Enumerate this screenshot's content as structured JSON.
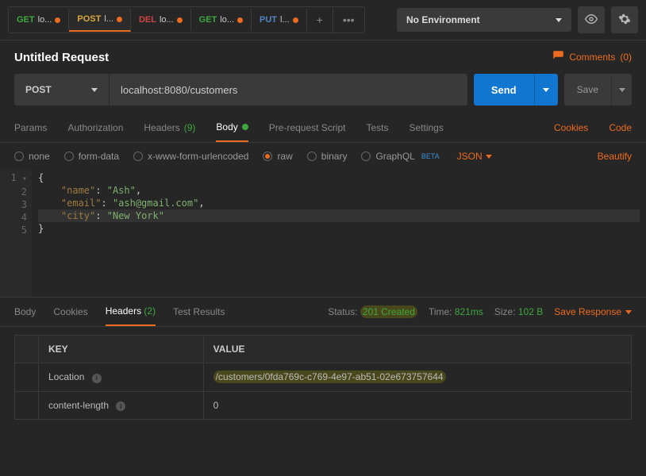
{
  "topBar": {
    "tabs": [
      {
        "method": "GET",
        "label": "lo...",
        "methodClass": "method-get"
      },
      {
        "method": "POST",
        "label": "l...",
        "methodClass": "method-post",
        "active": true
      },
      {
        "method": "DEL",
        "label": "lo...",
        "methodClass": "method-del"
      },
      {
        "method": "GET",
        "label": "lo...",
        "methodClass": "method-get"
      },
      {
        "method": "PUT",
        "label": "l...",
        "methodClass": "method-put"
      }
    ],
    "envLabel": "No Environment"
  },
  "request": {
    "title": "Untitled Request",
    "commentsLabel": "Comments",
    "commentsCount": "(0)",
    "method": "POST",
    "url": "localhost:8080/customers",
    "sendLabel": "Send",
    "saveLabel": "Save"
  },
  "reqTabs": {
    "params": "Params",
    "authorization": "Authorization",
    "headers": "Headers",
    "headersCount": "(9)",
    "body": "Body",
    "prerequest": "Pre-request Script",
    "tests": "Tests",
    "settings": "Settings",
    "cookies": "Cookies",
    "code": "Code"
  },
  "bodyOptions": {
    "none": "none",
    "formData": "form-data",
    "xwww": "x-www-form-urlencoded",
    "raw": "raw",
    "binary": "binary",
    "graphql": "GraphQL",
    "beta": "BETA",
    "json": "JSON",
    "beautify": "Beautify"
  },
  "editor": {
    "lines": [
      "1",
      "2",
      "3",
      "4",
      "5"
    ],
    "content": {
      "l1": "{",
      "l2a": "\"name\"",
      "l2b": ": ",
      "l2c": "\"Ash\"",
      "l2d": ",",
      "l3a": "\"email\"",
      "l3b": ": ",
      "l3c": "\"ash@gmail.com\"",
      "l3d": ",",
      "l4a": "\"city\"",
      "l4b": ": ",
      "l4c": "\"New York\"",
      "l5": "}"
    }
  },
  "respTabs": {
    "body": "Body",
    "cookies": "Cookies",
    "headers": "Headers",
    "headersCount": "(2)",
    "testResults": "Test Results"
  },
  "respMeta": {
    "statusLabel": "Status:",
    "statusVal": "201 Created",
    "timeLabel": "Time:",
    "timeVal": "821ms",
    "sizeLabel": "Size:",
    "sizeVal": "102 B",
    "saveResponse": "Save Response"
  },
  "respTable": {
    "keyHeader": "KEY",
    "valueHeader": "VALUE",
    "rows": [
      {
        "key": "Location",
        "value": "/customers/0fda769c-c769-4e97-ab51-02e673757644",
        "highlight": true
      },
      {
        "key": "content-length",
        "value": "0"
      }
    ]
  }
}
